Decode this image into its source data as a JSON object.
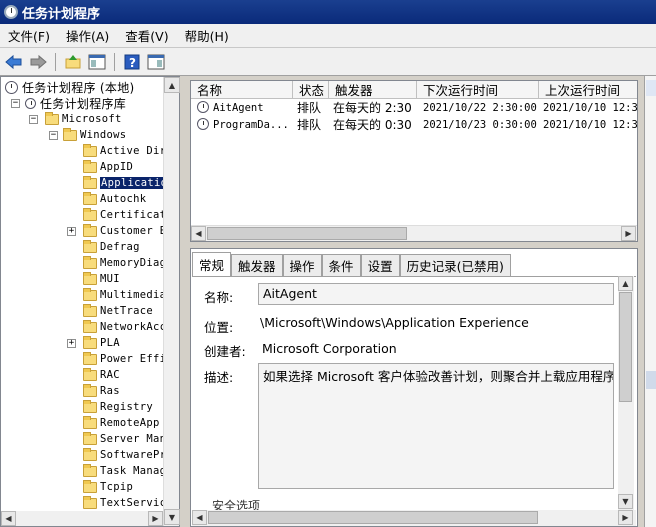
{
  "window": {
    "title": "任务计划程序"
  },
  "menu": [
    "文件(F)",
    "操作(A)",
    "查看(V)",
    "帮助(H)"
  ],
  "tree": {
    "root": "任务计划程序 (本地)",
    "library": "任务计划程序库",
    "microsoft": "Microsoft",
    "windows": "Windows",
    "folders": [
      {
        "label": "Active Dir",
        "expandable": false
      },
      {
        "label": "AppID",
        "expandable": false
      },
      {
        "label": "Application",
        "expandable": false,
        "selected": true
      },
      {
        "label": "Autochk",
        "expandable": false
      },
      {
        "label": "Certificat",
        "expandable": false
      },
      {
        "label": "Customer E",
        "expandable": true
      },
      {
        "label": "Defrag",
        "expandable": false
      },
      {
        "label": "MemoryDiag",
        "expandable": false
      },
      {
        "label": "MUI",
        "expandable": false
      },
      {
        "label": "Multimedia",
        "expandable": false
      },
      {
        "label": "NetTrace",
        "expandable": false
      },
      {
        "label": "NetworkAcc",
        "expandable": false
      },
      {
        "label": "PLA",
        "expandable": true
      },
      {
        "label": "Power Effi",
        "expandable": false
      },
      {
        "label": "RAC",
        "expandable": false
      },
      {
        "label": "Ras",
        "expandable": false
      },
      {
        "label": "Registry",
        "expandable": false
      },
      {
        "label": "RemoteApp",
        "expandable": false
      },
      {
        "label": "Server Man",
        "expandable": false
      },
      {
        "label": "SoftwarePr",
        "expandable": false
      },
      {
        "label": "Task Manag",
        "expandable": false
      },
      {
        "label": "Tcpip",
        "expandable": false
      },
      {
        "label": "TextServic",
        "expandable": false
      }
    ]
  },
  "tasklist": {
    "headers": [
      "名称",
      "状态",
      "触发器",
      "下次运行时间",
      "上次运行时间"
    ],
    "rows": [
      {
        "name": "AitAgent",
        "status": "排队",
        "trigger": "在每天的 2:30",
        "next": "2021/10/22 2:30:00",
        "last": "2021/10/10 12:3"
      },
      {
        "name": "ProgramDa...",
        "status": "排队",
        "trigger": "在每天的 0:30",
        "next": "2021/10/23 0:30:00",
        "last": "2021/10/10 12:3"
      }
    ]
  },
  "detail": {
    "tabs": [
      "常规",
      "触发器",
      "操作",
      "条件",
      "设置",
      "历史记录(已禁用)"
    ],
    "name_label": "名称:",
    "name_value": "AitAgent",
    "location_label": "位置:",
    "location_value": "\\Microsoft\\Windows\\Application Experience",
    "author_label": "创建者:",
    "author_value": "Microsoft Corporation",
    "desc_label": "描述:",
    "desc_value": "如果选择 Microsoft 客户体验改善计划，则聚合并上载应用程序遥",
    "security_label": "安全选项"
  },
  "colors": {
    "titlebar": "#0a2a7a",
    "selection": "#0a246a"
  }
}
